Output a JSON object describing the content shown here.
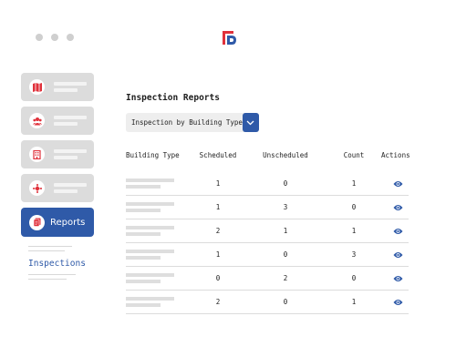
{
  "window": {
    "dots": 3
  },
  "brand": {
    "logo_icon": "brand-logo-icon",
    "colors": {
      "red": "#e0313b",
      "blue": "#2f5aa8"
    }
  },
  "sidebar": {
    "items": [
      {
        "icon": "map-icon",
        "active": false,
        "label": ""
      },
      {
        "icon": "users-icon",
        "active": false,
        "label": ""
      },
      {
        "icon": "building-icon",
        "active": false,
        "label": ""
      },
      {
        "icon": "network-icon",
        "active": false,
        "label": ""
      },
      {
        "icon": "report-icon",
        "active": true,
        "label": "Reports"
      }
    ],
    "sub": {
      "label": "Inspections"
    }
  },
  "main": {
    "title": "Inspection Reports",
    "select": {
      "value": "Inspection by Building Type"
    },
    "table": {
      "headers": [
        "Building Type",
        "Scheduled",
        "Unscheduled",
        "Count",
        "Actions"
      ],
      "rows": [
        {
          "scheduled": "1",
          "unscheduled": "0",
          "count": "1"
        },
        {
          "scheduled": "1",
          "unscheduled": "3",
          "count": "0"
        },
        {
          "scheduled": "2",
          "unscheduled": "1",
          "count": "1"
        },
        {
          "scheduled": "1",
          "unscheduled": "0",
          "count": "3"
        },
        {
          "scheduled": "0",
          "unscheduled": "2",
          "count": "0"
        },
        {
          "scheduled": "2",
          "unscheduled": "0",
          "count": "1"
        }
      ],
      "action_icon": "eye-icon"
    }
  }
}
